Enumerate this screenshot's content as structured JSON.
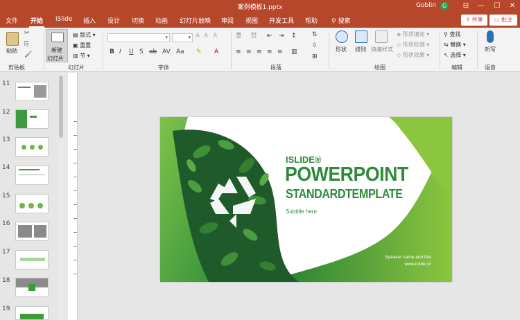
{
  "titlebar": {
    "doc_title": "案例模板1.pptx",
    "user_name": "Goblin",
    "avatar_initial": "G"
  },
  "tabs": [
    "文件",
    "开始",
    "iSlide",
    "插入",
    "设计",
    "切换",
    "动画",
    "幻灯片放映",
    "审阅",
    "视图",
    "开发工具",
    "帮助"
  ],
  "search_label": "搜索",
  "share_label": "共享",
  "comment_label": "批注",
  "ribbon": {
    "paste_label": "粘贴",
    "clipboard_group": "剪贴板",
    "new_slide_label": "新建",
    "new_slide_label2": "幻灯片",
    "layout_label": "版式",
    "reset_label": "重置",
    "section_label": "节",
    "slides_group": "幻灯片",
    "font_group": "字体",
    "paragraph_group": "段落",
    "shape_label": "形状",
    "arrange_label": "排列",
    "quick_style_label": "快速样式",
    "shape_fill_label": "形状填充",
    "shape_outline_label": "形状轮廓",
    "shape_effect_label": "形状效果",
    "drawing_group": "绘图",
    "find_label": "查找",
    "replace_label": "替换",
    "select_label": "选择",
    "editing_group": "编辑",
    "dictate_label": "听写",
    "voice_group": "语音"
  },
  "thumbnails": [
    "11",
    "12",
    "13",
    "14",
    "15",
    "16",
    "17",
    "18",
    "19"
  ],
  "slide": {
    "islide": "ISLIDE®",
    "title1": "POWERPOINT",
    "title2": "STANDARDTEMPLATE",
    "subtitle": "Subtitle here",
    "speaker": "Speaker name and title",
    "url": "www.islide.cc"
  },
  "colors": {
    "titlebar": "#b7472a",
    "brand_green": "#2e8b3a",
    "light_green": "#8cc63f"
  }
}
